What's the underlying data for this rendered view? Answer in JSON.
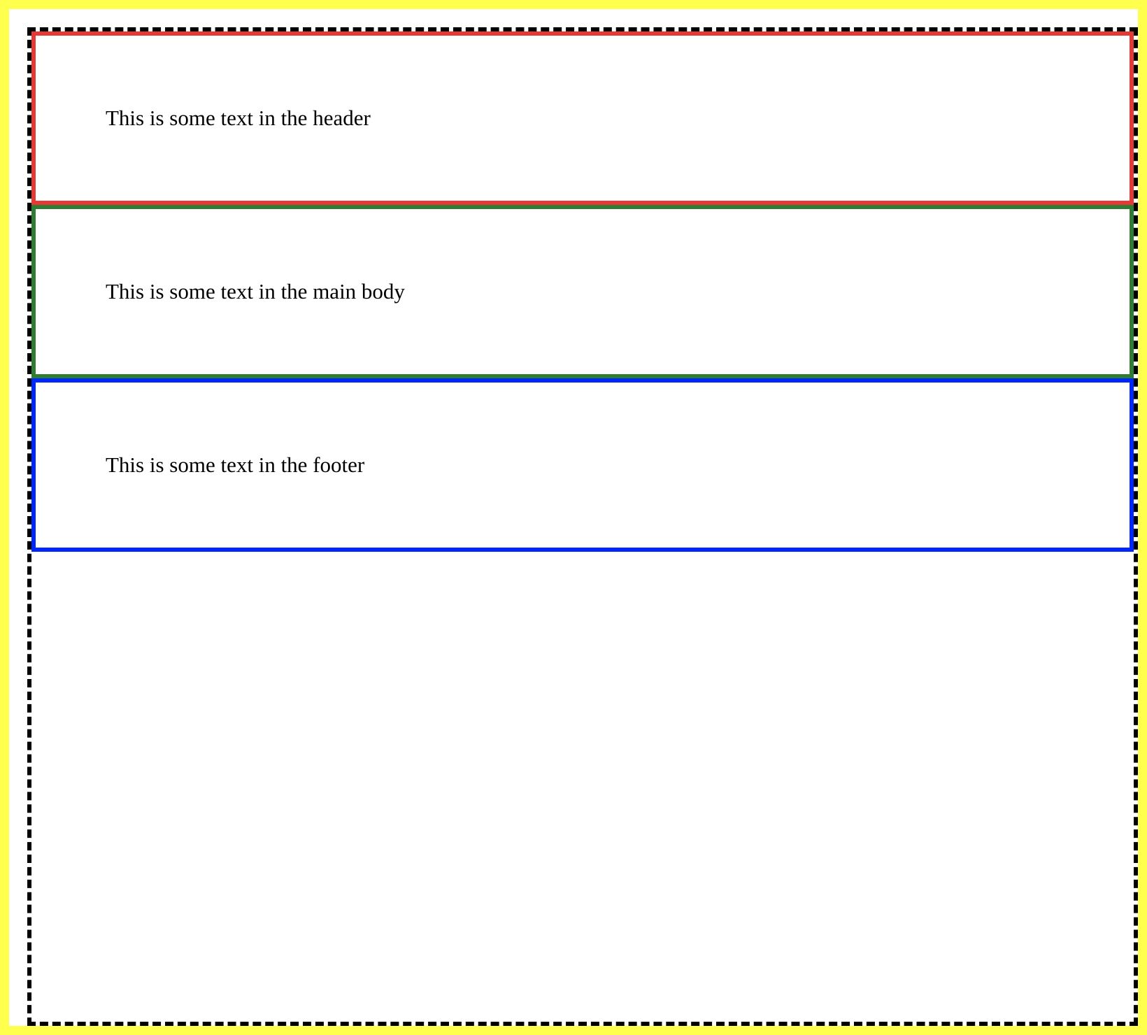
{
  "colors": {
    "outer_border": "#ffff4d",
    "container_border": "#000000",
    "header_border": "#e53935",
    "main_border": "#2e7d32",
    "footer_border": "#0026ff"
  },
  "header": {
    "text": "This is some text in the header"
  },
  "main": {
    "text": "This is some text in the main body"
  },
  "footer": {
    "text": "This is some text in the footer"
  }
}
